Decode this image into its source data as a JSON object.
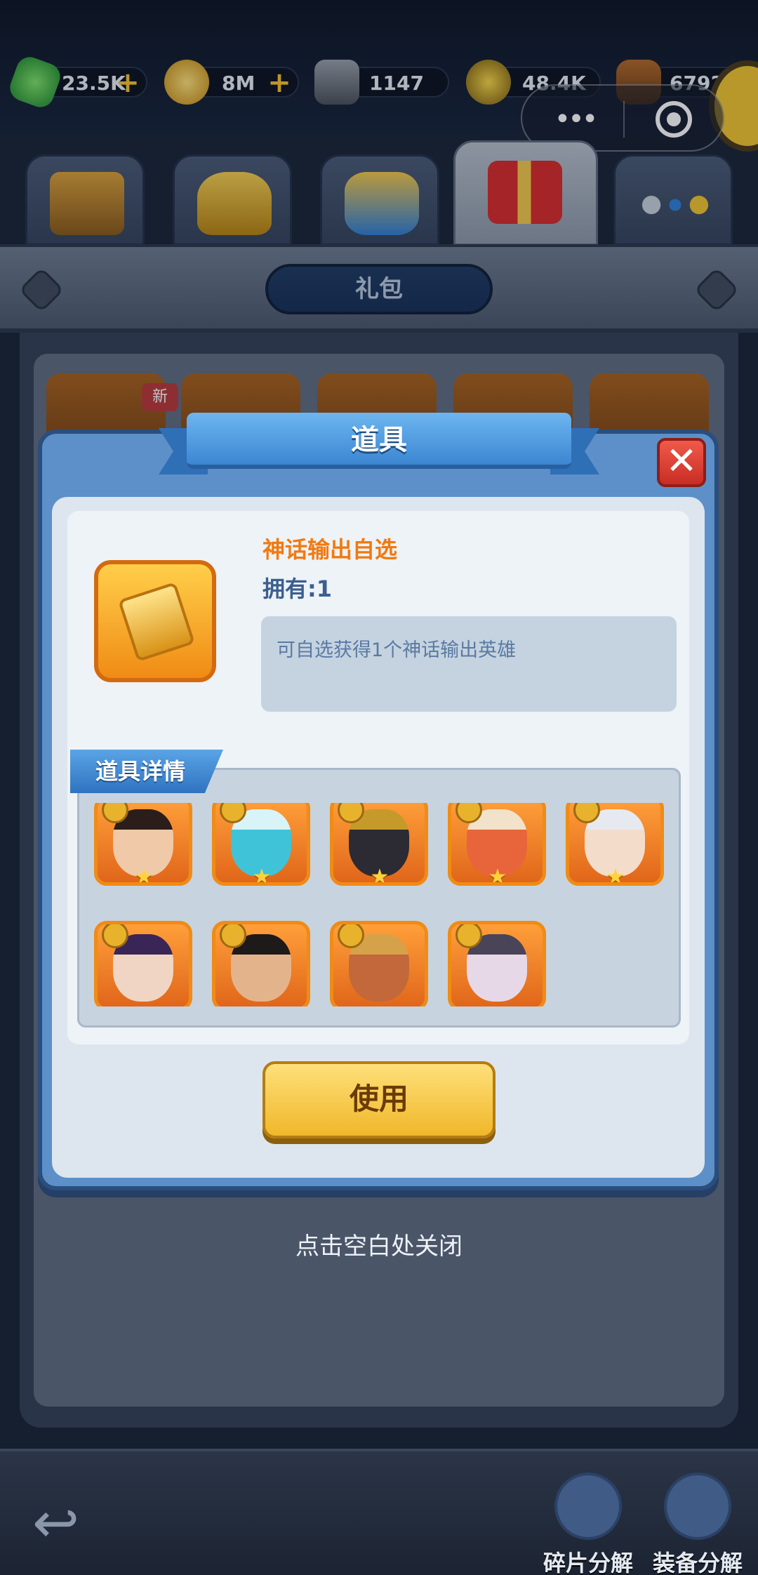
{
  "resources": [
    {
      "icon": "green-gem-icon",
      "value": "23.5K",
      "has_plus": true
    },
    {
      "icon": "gold-coin-icon",
      "value": "8M",
      "has_plus": true
    },
    {
      "icon": "iron-ore-icon",
      "value": "1147",
      "has_plus": false
    },
    {
      "icon": "star-medal-icon",
      "value": "48.4K",
      "has_plus": false
    },
    {
      "icon": "barrel-icon",
      "value": "6792",
      "has_plus": false
    }
  ],
  "plus_symbol": "+",
  "capsule": {
    "more": "•••"
  },
  "tabs": [
    {
      "icon": "treasure-chest-icon",
      "active": false
    },
    {
      "icon": "golden-armor-icon",
      "active": false
    },
    {
      "icon": "puzzle-piece-icon",
      "active": false
    },
    {
      "icon": "gift-box-icon",
      "active": true
    },
    {
      "icon": "orbs-icon",
      "active": false
    }
  ],
  "section_title": "礼包",
  "under_cards": {
    "new_tag": "新"
  },
  "modal": {
    "title": "道具",
    "close_symbol": "✕",
    "item": {
      "icon": "hero-card-icon",
      "name": "神话输出自选",
      "owned": "拥有:1",
      "description": "可自选获得1个神话输出英雄"
    },
    "detail_tab": "道具详情",
    "heroes": [
      {
        "icon": "hero-portrait-1",
        "face_color": "#f0c9a8",
        "hair_color": "#2b1e1a"
      },
      {
        "icon": "hero-portrait-2",
        "face_color": "#3fc3d8",
        "hair_color": "#d8f4f8"
      },
      {
        "icon": "hero-portrait-3",
        "face_color": "#2c2a33",
        "hair_color": "#c69a2a"
      },
      {
        "icon": "hero-portrait-4",
        "face_color": "#e8643a",
        "hair_color": "#f2e2c9"
      },
      {
        "icon": "hero-portrait-5",
        "face_color": "#f4dccb",
        "hair_color": "#e6e9f0"
      },
      {
        "icon": "hero-portrait-6",
        "face_color": "#f1d5c4",
        "hair_color": "#3a2557"
      },
      {
        "icon": "hero-portrait-7",
        "face_color": "#e3b48b",
        "hair_color": "#1e1a1a"
      },
      {
        "icon": "hero-portrait-8",
        "face_color": "#c2683a",
        "hair_color": "#d5a24a"
      },
      {
        "icon": "hero-portrait-9",
        "face_color": "#e7d8e8",
        "hair_color": "#4a4458"
      }
    ],
    "star_symbol": "★",
    "use_button": "使用"
  },
  "close_hint": "点击空白处关闭",
  "bottom": {
    "back_symbol": "↩",
    "buttons": [
      {
        "icon": "shard-decompose-icon",
        "label": "碎片分解"
      },
      {
        "icon": "anvil-decompose-icon",
        "label": "装备分解"
      }
    ]
  },
  "colors": {
    "accent_blue": "#3c86d2",
    "gold": "#f0b72a",
    "orange_name": "#f07a12",
    "close_red": "#c92d24"
  }
}
